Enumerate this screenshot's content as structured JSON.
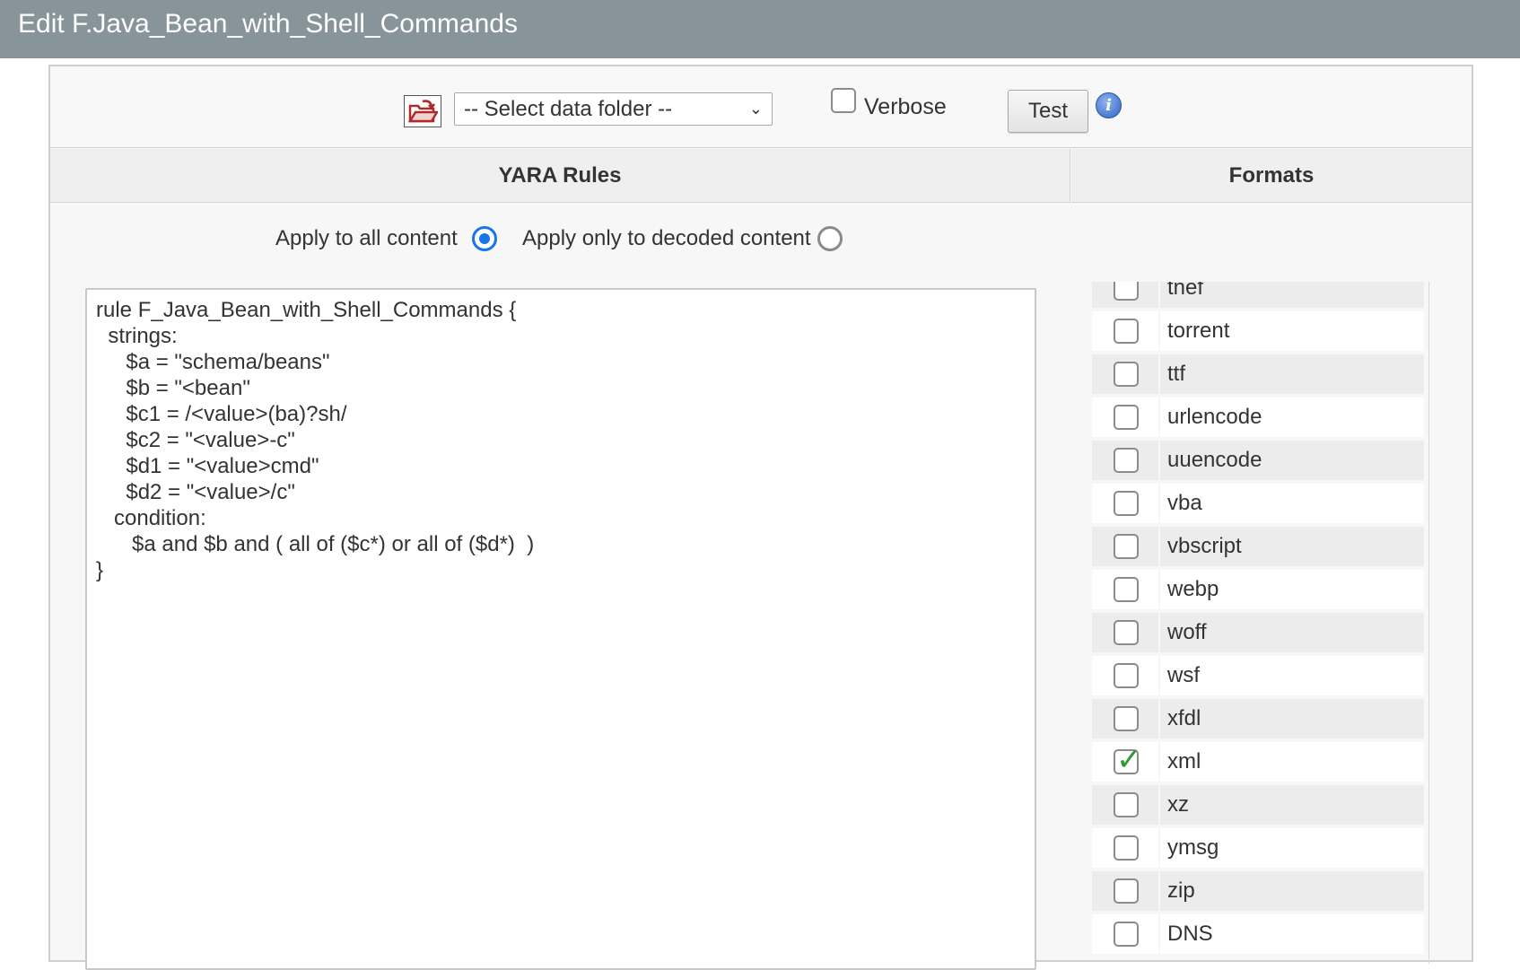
{
  "window": {
    "title": "Edit F.Java_Bean_with_Shell_Commands"
  },
  "toolbar": {
    "folder_select_value": "-- Select data folder --",
    "verbose_label": "Verbose",
    "verbose_checked": false,
    "test_label": "Test",
    "info_glyph": "i"
  },
  "columns": {
    "yara": "YARA Rules",
    "formats": "Formats"
  },
  "apply": {
    "all_label": "Apply to all content",
    "decoded_label": "Apply only to decoded content",
    "selected": "all"
  },
  "rule_text": "rule F_Java_Bean_with_Shell_Commands {\n  strings:\n     $a = \"schema/beans\"\n     $b = \"<bean\"\n     $c1 = /<value>(ba)?sh/\n     $c2 = \"<value>-c\"\n     $d1 = \"<value>cmd\"\n     $d2 = \"<value>/c\"\n   condition:\n      $a and $b and ( all of ($c*) or all of ($d*)  )\n}",
  "formats": [
    {
      "name": "tnef",
      "checked": false
    },
    {
      "name": "torrent",
      "checked": false
    },
    {
      "name": "ttf",
      "checked": false
    },
    {
      "name": "urlencode",
      "checked": false
    },
    {
      "name": "uuencode",
      "checked": false
    },
    {
      "name": "vba",
      "checked": false
    },
    {
      "name": "vbscript",
      "checked": false
    },
    {
      "name": "webp",
      "checked": false
    },
    {
      "name": "woff",
      "checked": false
    },
    {
      "name": "wsf",
      "checked": false
    },
    {
      "name": "xfdl",
      "checked": false
    },
    {
      "name": "xml",
      "checked": true
    },
    {
      "name": "xz",
      "checked": false
    },
    {
      "name": "ymsg",
      "checked": false
    },
    {
      "name": "zip",
      "checked": false
    },
    {
      "name": "DNS",
      "checked": false
    }
  ]
}
